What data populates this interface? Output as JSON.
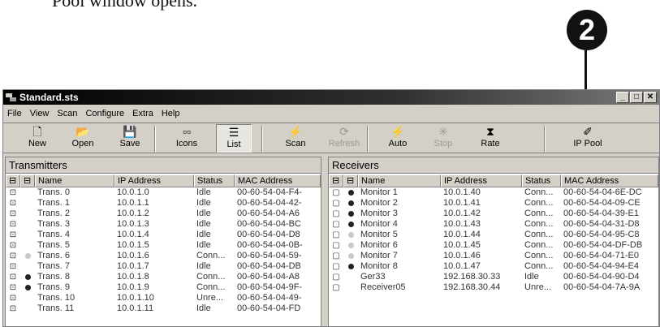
{
  "caption": "Pool window opens.",
  "callout_number": "2",
  "window": {
    "title": "Standard.sts",
    "buttons": [
      "_",
      "□",
      "✕"
    ]
  },
  "menu": [
    "File",
    "View",
    "Scan",
    "Configure",
    "Extra",
    "Help"
  ],
  "toolbar": [
    {
      "label": "New",
      "icon": "new-document-icon",
      "glyph": "🗋",
      "state": "normal"
    },
    {
      "label": "Open",
      "icon": "open-folder-icon",
      "glyph": "📂",
      "state": "normal"
    },
    {
      "label": "Save",
      "icon": "save-disk-icon",
      "glyph": "💾",
      "state": "normal"
    },
    {
      "label": "Icons",
      "icon": "icons-view-icon",
      "glyph": "▫▫",
      "state": "normal"
    },
    {
      "label": "List",
      "icon": "list-view-icon",
      "glyph": "☰",
      "state": "pressed"
    },
    {
      "label": "Scan",
      "icon": "scan-icon",
      "glyph": "⚡",
      "state": "normal"
    },
    {
      "label": "Refresh",
      "icon": "refresh-icon",
      "glyph": "⟳",
      "state": "disabled"
    },
    {
      "label": "Auto",
      "icon": "auto-icon",
      "glyph": "⚡",
      "state": "normal"
    },
    {
      "label": "Stop",
      "icon": "stop-icon",
      "glyph": "✳",
      "state": "disabled"
    },
    {
      "label": "Rate",
      "icon": "rate-hourglass-icon",
      "glyph": "⧗",
      "state": "normal"
    },
    {
      "label": "IP Pool",
      "icon": "ip-pool-icon",
      "glyph": "✐",
      "state": "normal"
    }
  ],
  "transmitters": {
    "title": "Transmitters",
    "columns": [
      "Name",
      "IP Address",
      "Status",
      "MAC Address"
    ],
    "rows": [
      {
        "name": "Trans. 0",
        "ip": "10.0.1.0",
        "status": "Idle",
        "mac": "00-60-54-04-F4-",
        "dot": "none"
      },
      {
        "name": "Trans. 1",
        "ip": "10.0.1.1",
        "status": "Idle",
        "mac": "00-60-54-04-42-",
        "dot": "none"
      },
      {
        "name": "Trans. 2",
        "ip": "10.0.1.2",
        "status": "Idle",
        "mac": "00-60-54-04-A6",
        "dot": "none"
      },
      {
        "name": "Trans. 3",
        "ip": "10.0.1.3",
        "status": "Idle",
        "mac": "00-60-54-04-BC",
        "dot": "none"
      },
      {
        "name": "Trans. 4",
        "ip": "10.0.1.4",
        "status": "Idle",
        "mac": "00-60-54-04-D8",
        "dot": "none"
      },
      {
        "name": "Trans. 5",
        "ip": "10.0.1.5",
        "status": "Idle",
        "mac": "00-60-54-04-0B-",
        "dot": "none"
      },
      {
        "name": "Trans. 6",
        "ip": "10.0.1.6",
        "status": "Conn...",
        "mac": "00-60-54-04-59-",
        "dot": "gray"
      },
      {
        "name": "Trans. 7",
        "ip": "10.0.1.7",
        "status": "Idle",
        "mac": "00-60-54-04-DB",
        "dot": "none"
      },
      {
        "name": "Trans. 8",
        "ip": "10.0.1.8",
        "status": "Conn...",
        "mac": "00-60-54-04-A8",
        "dot": "black"
      },
      {
        "name": "Trans. 9",
        "ip": "10.0.1.9",
        "status": "Conn...",
        "mac": "00-60-54-04-9F-",
        "dot": "black"
      },
      {
        "name": "Trans. 10",
        "ip": "10.0.1.10",
        "status": "Unre...",
        "mac": "00-60-54-04-49-",
        "dot": "none"
      },
      {
        "name": "Trans. 11",
        "ip": "10.0.1.11",
        "status": "Idle",
        "mac": "00-60-54-04-FD",
        "dot": "none"
      }
    ]
  },
  "receivers": {
    "title": "Receivers",
    "columns": [
      "Name",
      "IP Address",
      "Status",
      "MAC Address"
    ],
    "rows": [
      {
        "name": "Monitor 1",
        "ip": "10.0.1.40",
        "status": "Conn...",
        "mac": "00-60-54-04-6E-DC",
        "dot": "black"
      },
      {
        "name": "Monitor 2",
        "ip": "10.0.1.41",
        "status": "Conn...",
        "mac": "00-60-54-04-09-CE",
        "dot": "black"
      },
      {
        "name": "Monitor 3",
        "ip": "10.0.1.42",
        "status": "Conn...",
        "mac": "00-60-54-04-39-E1",
        "dot": "black"
      },
      {
        "name": "Monitor 4",
        "ip": "10.0.1.43",
        "status": "Conn...",
        "mac": "00-60-54-04-31-D8",
        "dot": "black"
      },
      {
        "name": "Monitor 5",
        "ip": "10.0.1.44",
        "status": "Conn...",
        "mac": "00-60-54-04-95-C8",
        "dot": "gray"
      },
      {
        "name": "Monitor 6",
        "ip": "10.0.1.45",
        "status": "Conn...",
        "mac": "00-60-54-04-DF-DB",
        "dot": "gray"
      },
      {
        "name": "Monitor 7",
        "ip": "10.0.1.46",
        "status": "Conn...",
        "mac": "00-60-54-04-71-E0",
        "dot": "gray"
      },
      {
        "name": "Monitor 8",
        "ip": "10.0.1.47",
        "status": "Conn...",
        "mac": "00-60-54-04-94-E4",
        "dot": "black"
      },
      {
        "name": "Ger33",
        "ip": "192.168.30.33",
        "status": "Idle",
        "mac": "00-60-54-04-90-D4",
        "dot": "none"
      },
      {
        "name": "Receiver05",
        "ip": "192.168.30.44",
        "status": "Unre...",
        "mac": "00-60-54-04-7A-9A",
        "dot": "none"
      }
    ]
  }
}
